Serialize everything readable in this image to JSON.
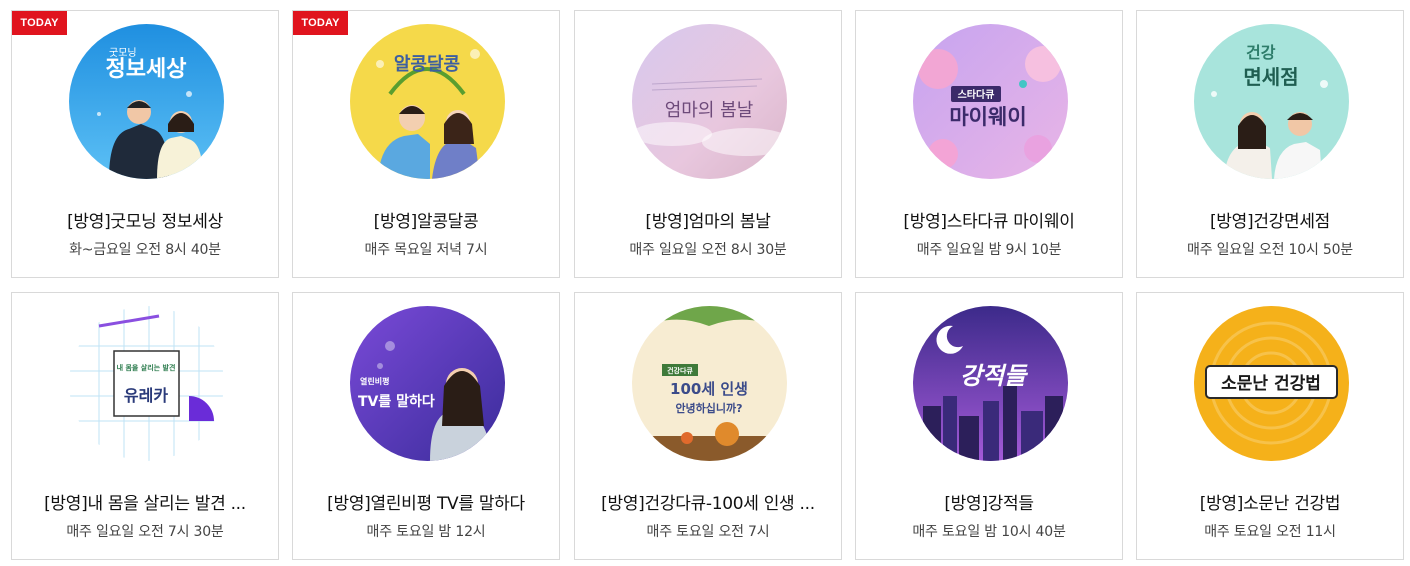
{
  "badge_text": "TODAY",
  "programs": [
    {
      "title": "[방영]굿모닝 정보세상",
      "schedule": "화~금요일 오전 8시 40분",
      "today": true,
      "thumb_text": "정보세상",
      "thumb_sub": "굿모닝",
      "icon": "good-morning-thumbnail"
    },
    {
      "title": "[방영]알콩달콩",
      "schedule": "매주 목요일 저녁 7시",
      "today": true,
      "thumb_text": "알콩달콩",
      "icon": "alkong-dalkong-thumbnail"
    },
    {
      "title": "[방영]엄마의 봄날",
      "schedule": "매주 일요일 오전 8시 30분",
      "today": false,
      "thumb_text": "엄마의 봄날",
      "icon": "mothers-spring-thumbnail"
    },
    {
      "title": "[방영]스타다큐 마이웨이",
      "schedule": "매주 일요일 밤 9시 10분",
      "today": false,
      "thumb_text": "마이웨이",
      "thumb_sub": "스타다큐",
      "icon": "my-way-thumbnail"
    },
    {
      "title": "[방영]건강면세점",
      "schedule": "매주 일요일 오전 10시 50분",
      "today": false,
      "thumb_text": "면세점",
      "thumb_sub": "건강",
      "icon": "health-dutyfree-thumbnail"
    },
    {
      "title": "[방영]내 몸을 살리는 발견 ...",
      "schedule": "매주 일요일 오전 7시 30분",
      "today": false,
      "thumb_text": "유레카",
      "thumb_sub": "내 몸을 살리는 발견",
      "icon": "eureka-thumbnail"
    },
    {
      "title": "[방영]열린비평 TV를 말하다",
      "schedule": "매주 토요일 밤 12시",
      "today": false,
      "thumb_text": "TV를 말하다",
      "thumb_sub": "열린비평",
      "icon": "open-criticism-thumbnail"
    },
    {
      "title": "[방영]건강다큐-100세 인생 ...",
      "schedule": "매주 토요일 오전 7시",
      "today": false,
      "thumb_text": "100세 인생",
      "thumb_sub": "안녕하십니까?",
      "icon": "centenarian-life-thumbnail"
    },
    {
      "title": "[방영]강적들",
      "schedule": "매주 토요일 밤 10시 40분",
      "today": false,
      "thumb_text": "강적들",
      "icon": "strong-enemies-thumbnail"
    },
    {
      "title": "[방영]소문난 건강법",
      "schedule": "매주 토요일 오전 11시",
      "today": false,
      "thumb_text": "소문난 건강법",
      "icon": "famous-health-thumbnail"
    }
  ]
}
